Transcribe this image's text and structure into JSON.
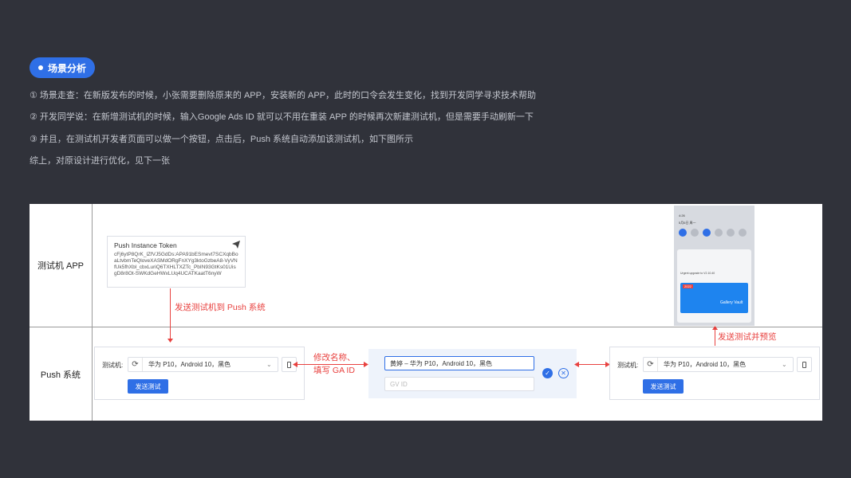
{
  "section": {
    "pill_label": "场景分析"
  },
  "descriptions": [
    "① 场景走查：在新版发布的时候，小张需要删除原来的 APP，安装新的 APP，此时的口令会发生变化，找到开发同学寻求技术帮助",
    "② 开发同学说：在新增测试机的时候，输入Google Ads ID 就可以不用在重装 APP 的时候再次新建测试机，但是需要手动刷新一下",
    "③ 并且，在测试机开发者页面可以做一个按钮，点击后，Push 系统自动添加该测试机，如下图所示",
    "综上，对原设计进行优化，见下一张"
  ],
  "rows": {
    "app_label": "测试机 APP",
    "push_label": "Push 系统"
  },
  "token_card": {
    "title": "Push Instance Token",
    "value": "cFj6ytP8QrK_lZfVJ5GdDs:APA91bESmevt7SCXqbBoaLtvbmTeQloveXASMdORgFnXYg3ktoGzbeA8-VyVNfUk5fhXbl_cbxLuriQ6TXHLTXZTc_PbIN93GtKs01UisgD8r8Ot-SWKdGeHWxLUq4UCATKaatT6nyW"
  },
  "annotations": {
    "send_to_push": "发送测试机到 Push 系统",
    "edit_name_line1": "修改名称、",
    "edit_name_line2": "填写 GA ID",
    "send_preview": "发送测试并预览"
  },
  "left_card": {
    "label": "测试机:",
    "select_value": "华为 P10，Android 10，黑色",
    "button": "发送测试"
  },
  "edit_panel": {
    "name_value": "黄婷 – 华为 P10，Android 10，黑色",
    "gaid_placeholder": "GV ID"
  },
  "right_card": {
    "label": "测试机:",
    "select_value": "华为 P10，Android 10，黑色",
    "button": "发送测试"
  },
  "phone": {
    "status": "4:26",
    "date": "5月6日 周一",
    "notif_line1": "Urgent upgrade to V2.10.40",
    "notif_line2": "Gallery Vault",
    "banner_year": "2022"
  },
  "colors": {
    "accent": "#2f6fe6",
    "annotation": "#e8413f",
    "background": "#30323a"
  }
}
